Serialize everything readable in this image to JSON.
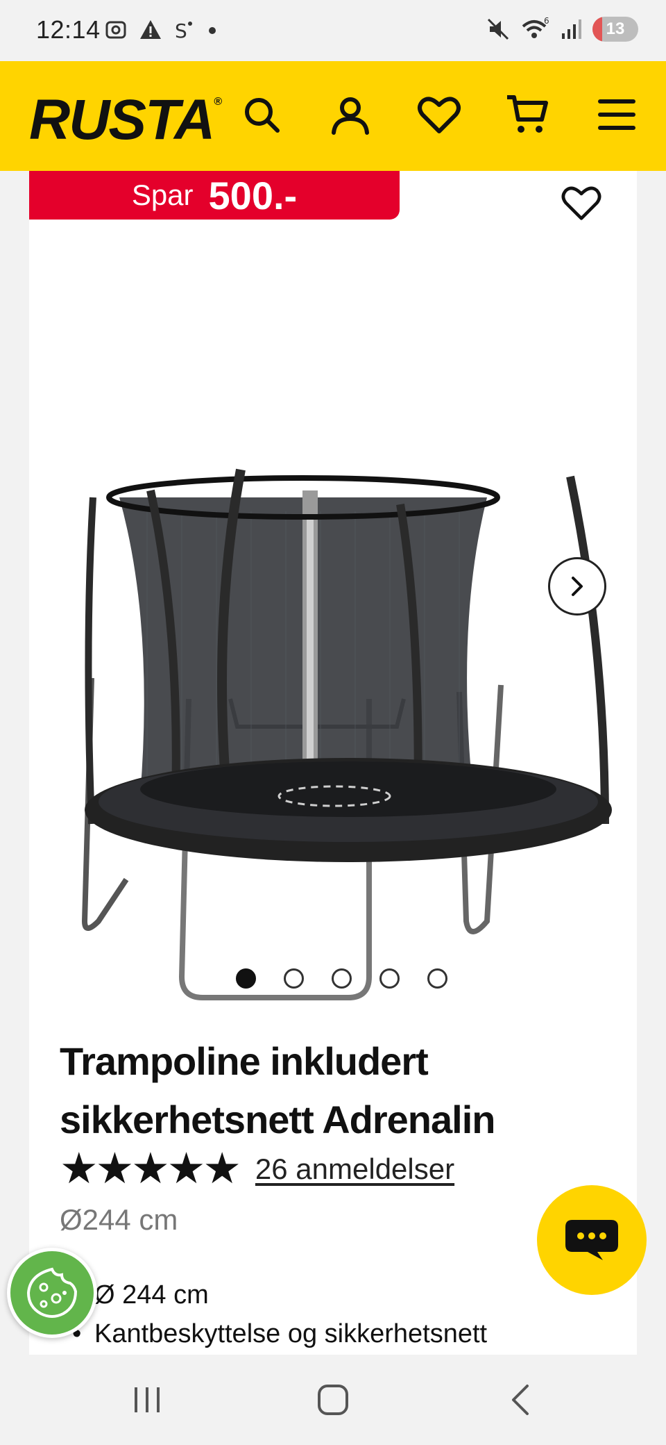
{
  "status_bar": {
    "time": "12:14",
    "left_icons": [
      "screenshot-icon",
      "warning-icon",
      "s-icon",
      "dot-icon"
    ],
    "right_icons": [
      "mute-icon",
      "wifi-icon",
      "signal-icon"
    ],
    "wifi_label": "6",
    "battery": "13"
  },
  "header": {
    "logo": "RUSTA",
    "logo_mark": "®",
    "icons": [
      "search-icon",
      "user-icon",
      "heart-icon",
      "cart-icon",
      "menu-icon"
    ]
  },
  "product": {
    "badge_prefix": "Spar",
    "badge_amount": "500.-",
    "image_alt": "Trampoline with safety net",
    "carousel_total": 5,
    "carousel_active": 1,
    "title": "Trampoline inkludert sikkerhetsnett Adrenalin",
    "rating_stars": "★★★★★",
    "rating_value": 5,
    "reviews": "26 anmeldelser",
    "size": "Ø244 cm",
    "bullets": [
      "Ø 244 cm",
      "Kantbeskyttelse og sikkerhetsnett"
    ]
  },
  "colors": {
    "brand_yellow": "#ffd400",
    "badge_red": "#e4002b",
    "cookie_green": "#62b54b"
  },
  "nav": {
    "icons": [
      "recent-apps-icon",
      "home-icon",
      "back-icon"
    ]
  }
}
